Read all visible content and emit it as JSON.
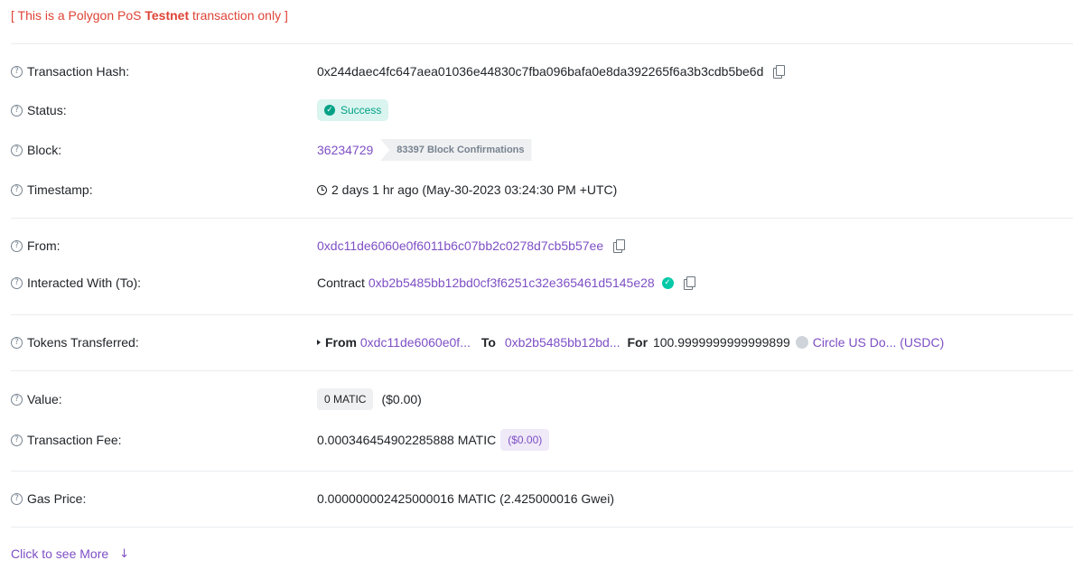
{
  "banner": {
    "prefix": "[ This is a Polygon PoS ",
    "strong": "Testnet",
    "suffix": " transaction only ]"
  },
  "rows": {
    "tx_hash": {
      "label": "Transaction Hash:",
      "value": "0x244daec4fc647aea01036e44830c7fba096bafa0e8da392265f6a3b3cdb5be6d"
    },
    "status": {
      "label": "Status:",
      "value": "Success"
    },
    "block": {
      "label": "Block:",
      "number": "36234729",
      "confirmations": "83397 Block Confirmations"
    },
    "timestamp": {
      "label": "Timestamp:",
      "value": "2 days 1 hr ago (May-30-2023 03:24:30 PM +UTC)"
    },
    "from": {
      "label": "From:",
      "value": "0xdc11de6060e0f6011b6c07bb2c0278d7cb5b57ee"
    },
    "to": {
      "label": "Interacted With (To):",
      "prefix": "Contract",
      "value": "0xb2b5485bb12bd0cf3f6251c32e365461d5145e28"
    },
    "tokens": {
      "label": "Tokens Transferred:",
      "from_label": "From",
      "from_value": "0xdc11de6060e0f...",
      "to_label": "To",
      "to_value": "0xb2b5485bb12bd...",
      "for_label": "For",
      "amount": "100.9999999999999899",
      "token": "Circle US Do... (USDC)"
    },
    "value": {
      "label": "Value:",
      "amount": "0 MATIC",
      "usd": "($0.00)"
    },
    "fee": {
      "label": "Transaction Fee:",
      "amount": "0.000346454902285888 MATIC",
      "usd": "($0.00)"
    },
    "gas": {
      "label": "Gas Price:",
      "value": "0.000000002425000016 MATIC (2.425000016 Gwei)"
    }
  },
  "more": {
    "label": "Click to see More"
  },
  "colors": {
    "link": "#7e4fc4",
    "success": "#00a186",
    "banner": "#de4437"
  },
  "icons": {
    "help": "question-circle-icon",
    "copy": "copy-icon",
    "check": "check-circle-icon",
    "clock": "clock-icon",
    "arrow": "arrow-down-icon"
  }
}
